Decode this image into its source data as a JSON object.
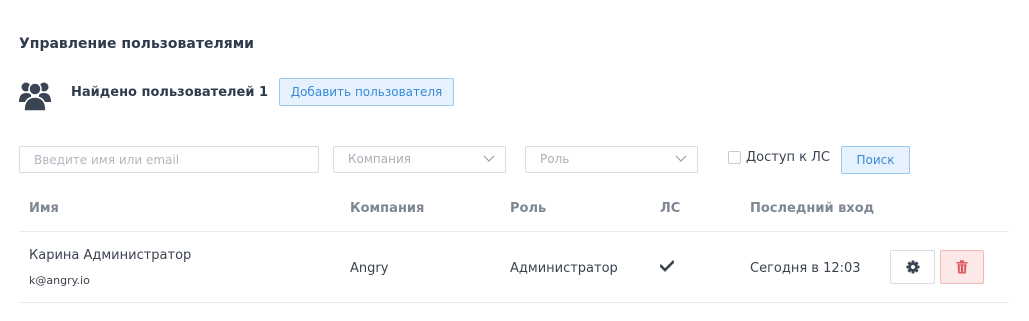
{
  "header": {
    "title": "Управление пользователями",
    "found_label": "Найдено пользователей 1",
    "add_button_label": "Добавить пользователя"
  },
  "filters": {
    "search_placeholder": "Введите имя или email",
    "company_placeholder": "Компания",
    "role_placeholder": "Роль",
    "ls_access_label": "Доступ к ЛС",
    "ls_access_checked": false,
    "search_button_label": "Поиск"
  },
  "table": {
    "columns": [
      "Имя",
      "Компания",
      "Роль",
      "ЛС",
      "Последний вход"
    ],
    "rows": [
      {
        "name": "Карина Администратор",
        "email": "k@angry.io",
        "company": "Angry",
        "role": "Администратор",
        "ls_access": true,
        "last_login": "Сегодня в 12:03"
      }
    ]
  },
  "icons": {
    "users": "users-icon",
    "chevron": "chevron-down-icon",
    "check": "check-icon",
    "settings": "gear-icon",
    "delete": "trash-icon"
  },
  "colors": {
    "accent": "#3a8ad8",
    "accent_bg": "#e5f2fd",
    "danger": "#e05a5a",
    "danger_bg": "#fde8e8",
    "title": "#2f3b4c"
  }
}
